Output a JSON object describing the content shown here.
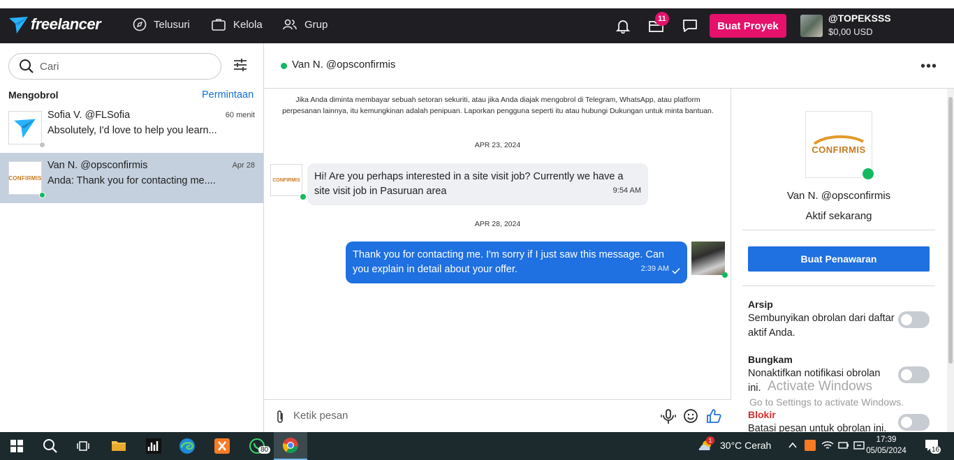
{
  "nav": {
    "logo": "freelancer",
    "links": [
      "Telusuri",
      "Kelola",
      "Grup"
    ],
    "notification_count": "11",
    "post_project": "Buat Proyek",
    "username": "@TOPEKSSS",
    "balance": "$0,00 USD"
  },
  "sidebar": {
    "search_placeholder": "Cari",
    "list_title": "Mengobrol",
    "requests_link": "Permintaan",
    "conversations": [
      {
        "name": "Sofia V. @FLSofia",
        "time": "60 menit",
        "preview": "Absolutely, I'd love to help you learn...",
        "status": "offline",
        "active": false
      },
      {
        "name": "Van N. @opsconfirmis",
        "time": "Apr 28",
        "preview": "Anda: Thank you for contacting me....",
        "status": "online",
        "active": true
      }
    ]
  },
  "chat": {
    "title": "Van N. @opsconfirmis",
    "warning": "Jika Anda diminta membayar sebuah setoran sekuriti, atau jika Anda diajak mengobrol di Telegram, WhatsApp, atau platform perpesanan lainnya, itu kemungkinan adalah penipuan. Laporkan pengguna seperti itu atau hubungi Dukungan untuk minta bantuan.",
    "messages": [
      {
        "date": "APR 23, 2024",
        "text": "Hi! Are you perhaps interested in a site visit job? Currently we have a site visit job in Pasuruan area",
        "time": "9:54 AM",
        "direction": "in"
      },
      {
        "date": "APR 28, 2024",
        "text": "Thank you for contacting me. I'm sorry if I just saw this message. Can you explain in detail about your offer.",
        "time": "2:39 AM",
        "direction": "out"
      }
    ],
    "composer_placeholder": "Ketik pesan"
  },
  "profile": {
    "brand_logo_text": "CONFIRMIS",
    "name": "Van N. @opsconfirmis",
    "status": "Aktif sekarang",
    "offer_button": "Buat Penawaran",
    "archive_title": "Arsip",
    "archive_desc": "Sembunyikan obrolan dari daftar aktif Anda.",
    "mute_title": "Bungkam",
    "mute_desc": "Nonaktifkan notifikasi obrolan ini.",
    "block_title": "Blokir",
    "block_desc": "Batasi pesan untuk obrolan ini."
  },
  "watermark": {
    "line1": "Activate Windows",
    "line2": "Go to Settings to activate Windows."
  },
  "taskbar": {
    "whatsapp_badge": "80",
    "weather_badge": "1",
    "weather": "30°C  Cerah",
    "time": "17:39",
    "date": "05/05/2024",
    "notif_count": "16"
  },
  "colors": {
    "brand_pink": "#e5116b",
    "accent_blue": "#1f70e0",
    "online_green": "#11b95f",
    "block_red": "#d62e2e",
    "nav_bg": "#1f1f23"
  }
}
